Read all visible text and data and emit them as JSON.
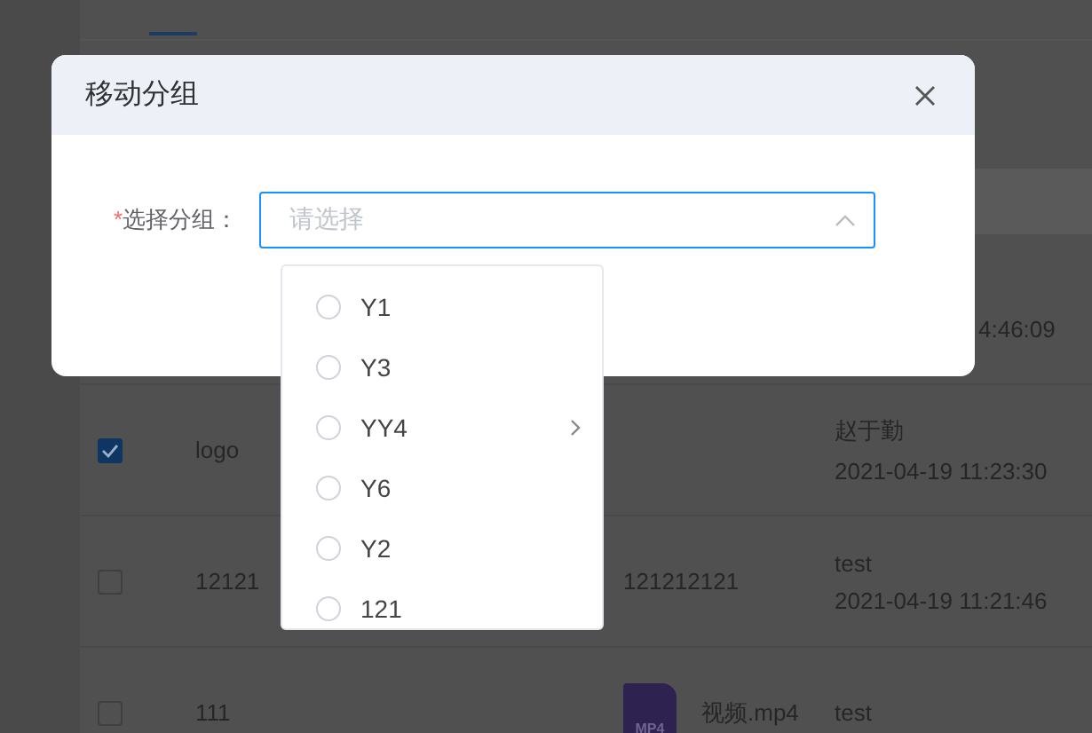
{
  "background_table": {
    "partial_time": "4:46:09",
    "rows": [
      {
        "checked": true,
        "name": "logo",
        "file": null,
        "user": "赵于勤",
        "time": "2021-04-19 11:23:30"
      },
      {
        "checked": false,
        "name": "12121",
        "file": {
          "kind": "text",
          "label": "121212121"
        },
        "user": "test",
        "time": "2021-04-19 11:21:46"
      },
      {
        "checked": false,
        "name": "111",
        "file": {
          "kind": "video",
          "badge": "MP4",
          "label": "视频.mp4"
        },
        "user": "test",
        "time": ""
      }
    ]
  },
  "dialog": {
    "title": "移动分组",
    "form": {
      "label": "选择分组：",
      "required_mark": "*",
      "placeholder": "请选择",
      "open": true
    },
    "options": [
      {
        "label": "Y1",
        "selected": false,
        "has_children": false
      },
      {
        "label": "Y3",
        "selected": false,
        "has_children": false
      },
      {
        "label": "YY4",
        "selected": false,
        "has_children": true
      },
      {
        "label": "Y6",
        "selected": false,
        "has_children": false
      },
      {
        "label": "Y2",
        "selected": false,
        "has_children": false
      },
      {
        "label": "121",
        "selected": false,
        "has_children": false
      }
    ]
  }
}
